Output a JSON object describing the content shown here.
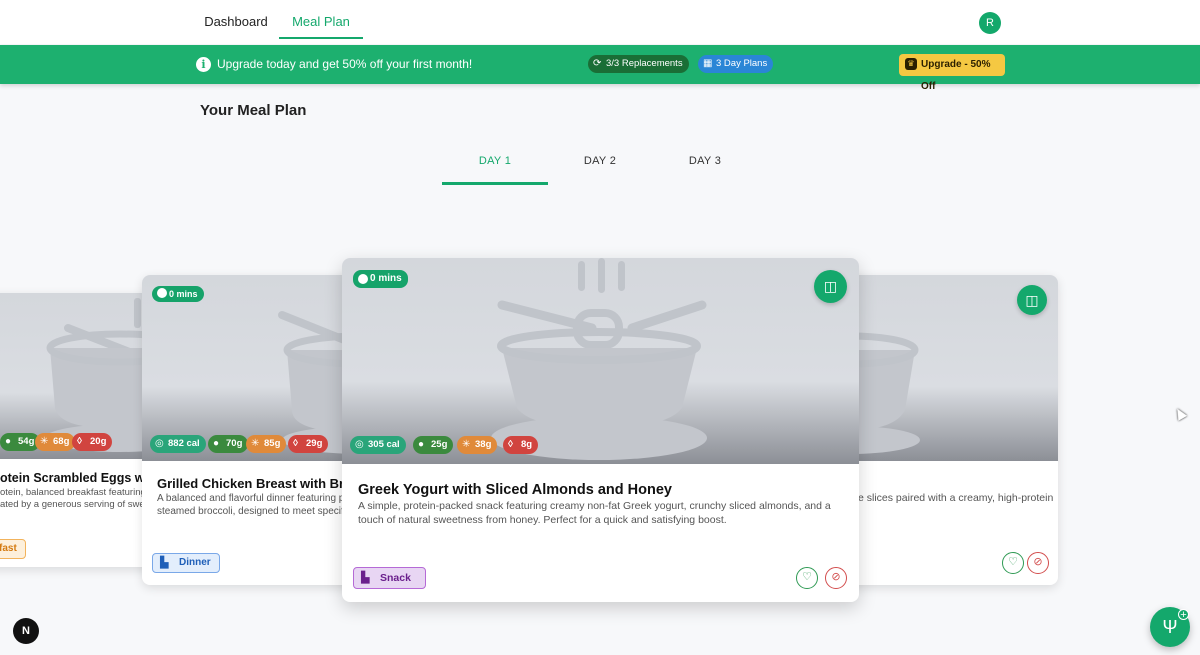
{
  "nav": {
    "tabs": [
      {
        "label": "Dashboard"
      },
      {
        "label": "Meal Plan"
      }
    ],
    "avatar_letter": "R"
  },
  "banner": {
    "message": "Upgrade today and get 50% off your first month!",
    "replacements": "3/3 Replacements",
    "day_plans": "3 Day Plans",
    "upgrade_label": "Upgrade - 50% Off"
  },
  "page_title": "Your Meal Plan",
  "days": [
    {
      "label": "DAY 1"
    },
    {
      "label": "DAY 2"
    },
    {
      "label": "DAY 3"
    }
  ],
  "cards": [
    {
      "time": "",
      "calories": "",
      "protein": "54g",
      "carbs": "68g",
      "fat": "20g",
      "title": "otein Scrambled Eggs with S",
      "desc": "otein, balanced breakfast featuring fluffy\nated by a generous serving of sweet m",
      "tag": "fast"
    },
    {
      "time": "0 mins",
      "calories": "882 cal",
      "protein": "70g",
      "carbs": "85g",
      "fat": "29g",
      "title": "Grilled Chicken Breast with Brow",
      "desc": "A balanced and flavorful dinner featuring pe\nsteamed broccoli, designed to meet specifi",
      "tag": "Dinner"
    },
    {
      "time": "0 mins",
      "calories": "305 cal",
      "protein": "25g",
      "carbs": "38g",
      "fat": "8g",
      "title": "Greek Yogurt with Sliced Almonds and Honey",
      "desc": "A simple, protein-packed snack featuring creamy non-fat Greek yogurt, crunchy sliced almonds, and a touch of natural sweetness from honey. Perfect for a quick and satisfying boost.",
      "tag": "Snack"
    },
    {
      "desc": "e slices paired with a creamy, high-protein"
    }
  ],
  "colors": {
    "brand_green": "#1db06f",
    "accent_green": "#14a86c",
    "upgrade_yellow": "#f5c842"
  }
}
